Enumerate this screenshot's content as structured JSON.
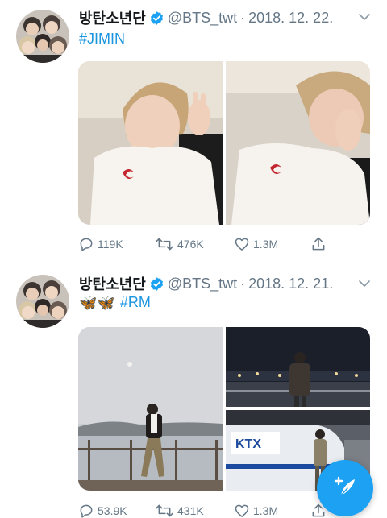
{
  "tweets": [
    {
      "display_name": "방탄소년단",
      "handle": "@BTS_twt",
      "separator": "·",
      "date": "2018. 12. 22.",
      "hashtag": "#JIMIN",
      "emoji_prefix": "",
      "media_count": 2,
      "actions": {
        "replies": "119K",
        "retweets": "476K",
        "likes": "1.3M"
      }
    },
    {
      "display_name": "방탄소년단",
      "handle": "@BTS_twt",
      "separator": "·",
      "date": "2018. 12. 21.",
      "hashtag": "#RM",
      "emoji_prefix": "🦋🦋",
      "media_count": 3,
      "actions": {
        "replies": "53.9K",
        "retweets": "431K",
        "likes": "1.3M"
      }
    }
  ],
  "icons": {
    "verified": "verified-badge-icon",
    "more": "chevron-down-icon",
    "reply": "reply-icon",
    "retweet": "retweet-icon",
    "like": "heart-icon",
    "share": "share-icon",
    "compose": "compose-tweet-icon"
  },
  "colors": {
    "brand_blue": "#1da1f2",
    "hashtag_blue": "#1b95e0",
    "secondary_text": "#657786",
    "divider": "#e1e8ed"
  }
}
